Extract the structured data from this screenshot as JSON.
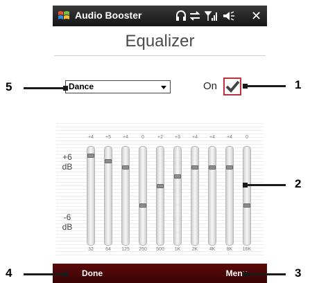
{
  "title_bar": {
    "app_title": "Audio Booster",
    "status_icons": [
      "headset-icon",
      "sync-icon",
      "signal-icon",
      "volume-icon"
    ]
  },
  "heading": "Equalizer",
  "preset": {
    "selected": "Dance"
  },
  "toggle": {
    "label": "On",
    "checked": true,
    "accent": "#c0303a"
  },
  "eq": {
    "db_top": [
      "+6",
      "dB"
    ],
    "db_bottom": [
      "-6",
      "dB"
    ],
    "bands": [
      {
        "freq": "32",
        "gain": "+4",
        "level": 0.92
      },
      {
        "freq": "64",
        "gain": "+5",
        "level": 0.86
      },
      {
        "freq": "125",
        "gain": "+4",
        "level": 0.8
      },
      {
        "freq": "250",
        "gain": "0",
        "level": 0.4
      },
      {
        "freq": "500",
        "gain": "+2",
        "level": 0.6
      },
      {
        "freq": "1K",
        "gain": "+3",
        "level": 0.7
      },
      {
        "freq": "2K",
        "gain": "+4",
        "level": 0.8
      },
      {
        "freq": "4K",
        "gain": "+4",
        "level": 0.8
      },
      {
        "freq": "8K",
        "gain": "+4",
        "level": 0.8
      },
      {
        "freq": "16K",
        "gain": "0",
        "level": 0.4
      }
    ]
  },
  "softkeys": {
    "left": "Done",
    "right": "Menu",
    "color": "#4a0505"
  },
  "callouts": [
    "1",
    "2",
    "3",
    "4",
    "5"
  ]
}
